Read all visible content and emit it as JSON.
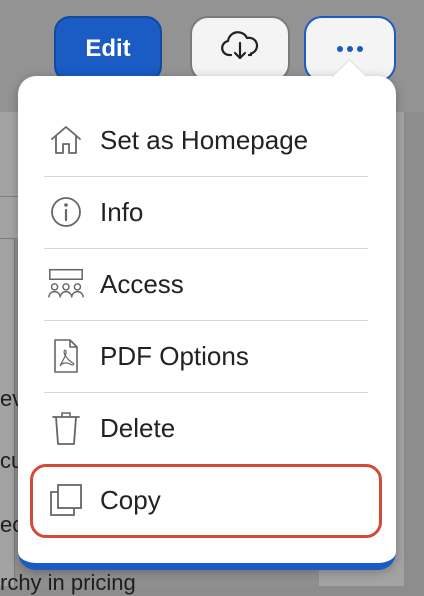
{
  "toolbar": {
    "edit_label": "Edit",
    "download_icon": "cloud-download-icon",
    "more_icon": "ellipsis-icon"
  },
  "menu": {
    "items": [
      {
        "label": "Set as Homepage",
        "icon": "home-icon"
      },
      {
        "label": "Info",
        "icon": "info-icon"
      },
      {
        "label": "Access",
        "icon": "people-icon"
      },
      {
        "label": "PDF Options",
        "icon": "pdf-file-icon"
      },
      {
        "label": "Delete",
        "icon": "trash-icon"
      },
      {
        "label": "Copy",
        "icon": "copy-icon"
      }
    ],
    "focused_item": "Copy"
  },
  "background_fragments": {
    "line1": "ev",
    "line2": "cu",
    "line3": "ec",
    "line4": "rchy in pricing"
  },
  "colors": {
    "accent": "#1a5bc4",
    "focus_ring": "#d24b3a"
  }
}
